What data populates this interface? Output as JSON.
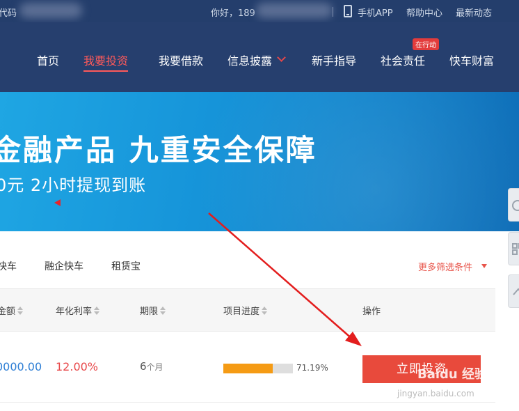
{
  "topbar": {
    "brand_fragment": "代码",
    "greeting": "你好，189",
    "app_label": "手机APP",
    "help_label": "帮助中心",
    "news_label": "最新动态"
  },
  "nav": {
    "items": [
      "首页",
      "我要投资",
      "我要借款",
      "信息披露",
      "新手指导",
      "社会责任",
      "快车财富"
    ],
    "active_index": 1,
    "badge": "在行动"
  },
  "banner": {
    "title": "金融产品  九重安全保障",
    "subtitle": "0元 2小时提现到账"
  },
  "categories": {
    "items": [
      "快车",
      "融企快车",
      "租赁宝"
    ],
    "more_filter": "更多筛选条件"
  },
  "table": {
    "headers": [
      "金额",
      "年化利率",
      "期限",
      "项目进度",
      "操作"
    ],
    "rows": [
      {
        "amount": "0000.00",
        "rate": "12.00%",
        "term_number": "6",
        "term_unit": "个月",
        "progress": 0.7119,
        "progress_text": "71.19%",
        "action": "立即投资"
      }
    ]
  },
  "watermark": {
    "logo_text": "Baidu 经验",
    "url": "jingyan.baidu.com"
  },
  "colors": {
    "nav_bg": "#263f6e",
    "accent_red": "#e84a3c",
    "progress_orange": "#f59b14",
    "link_blue": "#2f7fd5"
  }
}
